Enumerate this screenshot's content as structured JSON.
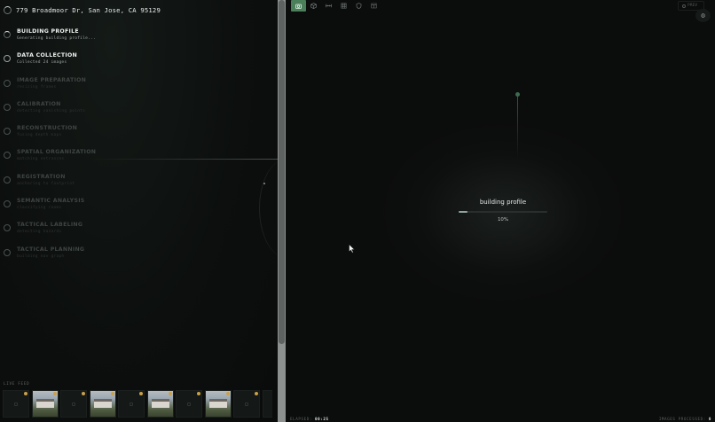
{
  "header": {
    "address": "779 Broadmoor Dr, San Jose, CA 95129"
  },
  "steps": [
    {
      "title": "BUILDING PROFILE",
      "sub": "Generating building profile...",
      "state": "active"
    },
    {
      "title": "DATA COLLECTION",
      "sub": "Collected 24 images",
      "state": "done"
    },
    {
      "title": "IMAGE PREPARATION",
      "sub": "resizing frames",
      "state": "pending"
    },
    {
      "title": "CALIBRATION",
      "sub": "detecting vanishing points",
      "state": "pending"
    },
    {
      "title": "RECONSTRUCTION",
      "sub": "fusing depth maps",
      "state": "pending"
    },
    {
      "title": "SPATIAL ORGANIZATION",
      "sub": "matching entrances",
      "state": "pending"
    },
    {
      "title": "REGISTRATION",
      "sub": "anchoring to footprint",
      "state": "pending"
    },
    {
      "title": "SEMANTIC ANALYSIS",
      "sub": "classifying rooms",
      "state": "pending"
    },
    {
      "title": "TACTICAL LABELING",
      "sub": "detecting hazards",
      "state": "pending"
    },
    {
      "title": "TACTICAL PLANNING",
      "sub": "building nav graph",
      "state": "pending"
    }
  ],
  "feed": {
    "label": "LIVE FEED",
    "thumbs": [
      "placeholder",
      "photo",
      "placeholder",
      "photo",
      "placeholder",
      "photo",
      "placeholder",
      "photo",
      "placeholder",
      "placeholder"
    ]
  },
  "toolbar": {
    "buttons": [
      "camera-icon",
      "cube-icon",
      "ruler-icon",
      "grid-icon",
      "shield-icon",
      "layers-icon"
    ],
    "active_index": 0,
    "right_label": "PREV"
  },
  "viewer": {
    "status_label": "building profile",
    "progress_percent": 10,
    "progress_text": "10%"
  },
  "footer": {
    "elapsed_label": "ELAPSED:",
    "elapsed_value": "00:25",
    "images_label": "IMAGES PROCESSED:",
    "images_value": "0"
  },
  "colors": {
    "accent": "#4a7f5a",
    "badge": "#c9a14a",
    "background": "#0b0c0c"
  }
}
